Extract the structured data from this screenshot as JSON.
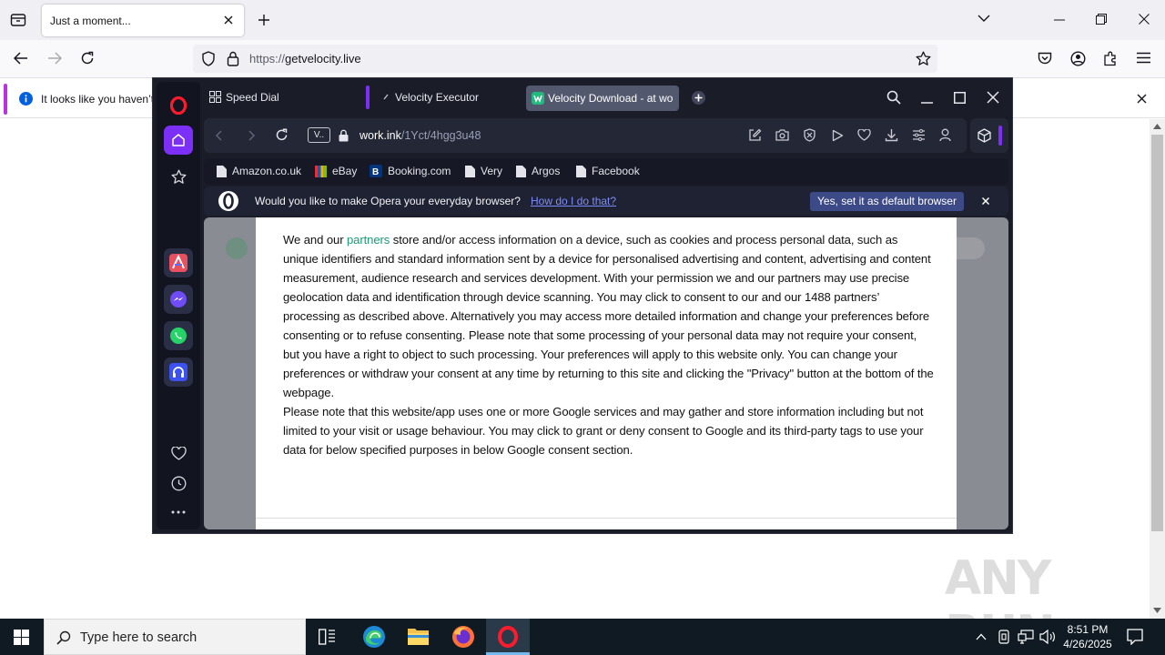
{
  "firefox": {
    "tab": {
      "title": "Just a moment..."
    },
    "url": {
      "scheme": "https://",
      "host": "getvelocity.live"
    },
    "notice": {
      "text": "It looks like you haven’t"
    }
  },
  "opera": {
    "tabs": [
      {
        "label": "Speed Dial"
      },
      {
        "label": "Velocity Executor"
      },
      {
        "label": "Velocity Download - at wo"
      }
    ],
    "address": {
      "badge": "V..",
      "host": "work.ink",
      "path": "/1Yct/4hgg3u48"
    },
    "bookmarks": [
      "Amazon.co.uk",
      "eBay",
      "Booking.com",
      "Very",
      "Argos",
      "Facebook"
    ],
    "banner": {
      "text": "Would you like to make Opera your everyday browser?",
      "link": "How do I do that?",
      "button": "Yes, set it as default browser"
    },
    "consent": {
      "p1_start": "We and our",
      "partners_link": "partners",
      "p1_rest": "store and/or access information on a device, such as cookies and process personal data, such as unique identifiers and standard information sent by a device for personalised advertising and content, advertising and content measurement, audience research and services development. With your permission we and our partners may use precise geolocation data and identification through device scanning. You may click to consent to our and our 1488 partners’ processing as described above. Alternatively you may access more detailed information and change your preferences before consenting or to refuse consenting. Please note that some processing of your personal data may not require your consent, but you have a right to object to such processing. Your preferences will apply to this website only. You can change your preferences or withdraw your consent at any time by returning to this site and clicking the \"Privacy\" button at the bottom of the webpage.",
      "p2": "Please note that this website/app uses one or more Google services and may gather and store information including but not limited to your visit or usage behaviour. You may click to grant or deny consent to Google and its third-party tags to use your data for below specified purposes in below Google consent section."
    }
  },
  "taskbar": {
    "search_placeholder": "Type here to search",
    "time": "8:51 PM",
    "date": "4/26/2025"
  },
  "watermark": "ANY RUN",
  "colors": {
    "opera_accent": "#7b2ff7",
    "opera_red": "#ff1b2d",
    "partners_green": "#1b9b73",
    "banner_button": "#3d4a88"
  }
}
